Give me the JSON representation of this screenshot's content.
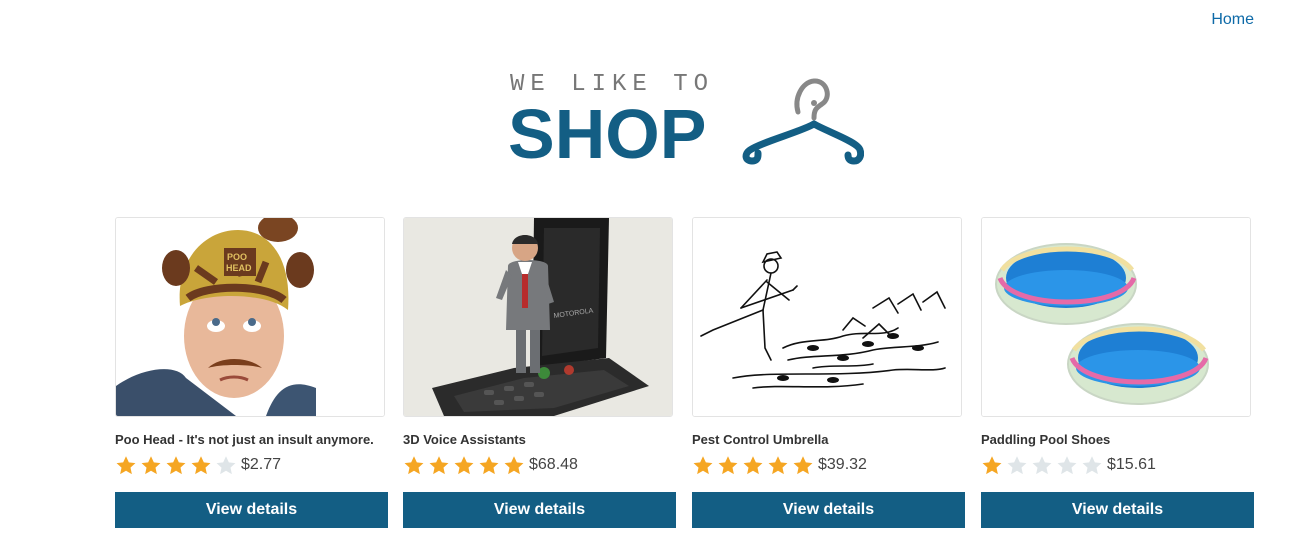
{
  "nav": {
    "home_label": "Home"
  },
  "logo": {
    "tagline": "WE LIKE TO",
    "word": "SHOP"
  },
  "colors": {
    "brand": "#135e84",
    "link": "#0e6aa8",
    "star_filled": "#f5a623",
    "star_empty": "#dfe5e8"
  },
  "products": [
    {
      "name": "Poo Head - It's not just an insult anymore.",
      "rating": 4,
      "max_rating": 5,
      "price": "$2.77",
      "button_label": "View details"
    },
    {
      "name": "3D Voice Assistants",
      "rating": 5,
      "max_rating": 5,
      "price": "$68.48",
      "button_label": "View details"
    },
    {
      "name": "Pest Control Umbrella",
      "rating": 5,
      "max_rating": 5,
      "price": "$39.32",
      "button_label": "View details"
    },
    {
      "name": "Paddling Pool Shoes",
      "rating": 1,
      "max_rating": 5,
      "price": "$15.61",
      "button_label": "View details"
    }
  ]
}
